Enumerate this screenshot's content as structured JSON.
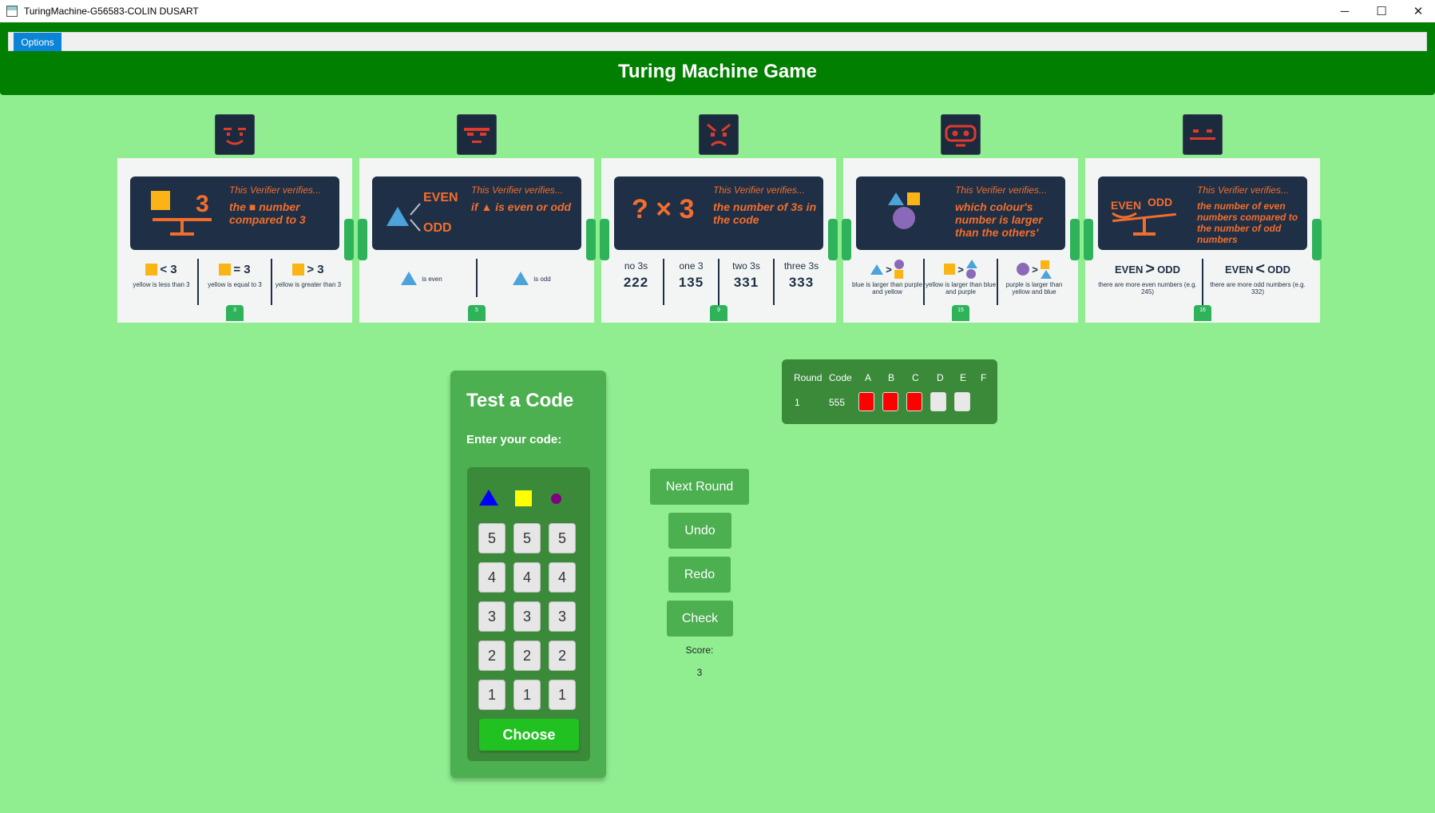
{
  "window": {
    "title": "TuringMachine-G56583-COLIN DUSART",
    "minimize": "─",
    "maximize": "☐",
    "close": "✕"
  },
  "menu": {
    "options_label": "Options"
  },
  "header": {
    "title": "Turing Machine Game"
  },
  "verifiers": [
    {
      "card_title": "This Verifier verifies...",
      "text": "the ■ number compared to 3",
      "number": "3",
      "options": [
        {
          "symbol": "< 3",
          "caption": "yellow is less than 3"
        },
        {
          "symbol": "= 3",
          "caption": "yellow is equal to 3"
        },
        {
          "symbol": "> 3",
          "caption": "yellow is greater than 3"
        }
      ]
    },
    {
      "card_title": "This Verifier verifies...",
      "text": "if ▲ is even or odd",
      "number": "5",
      "panel_even": "EVEN",
      "panel_odd": "ODD",
      "options": [
        {
          "caption": "is even"
        },
        {
          "caption": "is odd"
        }
      ]
    },
    {
      "card_title": "This Verifier verifies...",
      "text": "the number of 3s in the code",
      "number": "9",
      "panel_symbol": "? × 3",
      "options": [
        {
          "label": "no 3s",
          "digits": "222"
        },
        {
          "label": "one 3",
          "digits": "135"
        },
        {
          "label": "two 3s",
          "digits": "331"
        },
        {
          "label": "three 3s",
          "digits": "333"
        }
      ]
    },
    {
      "card_title": "This Verifier verifies...",
      "text": "which colour's number is larger than the others'",
      "number": "15",
      "options": [
        {
          "caption": "blue is larger than purple and yellow"
        },
        {
          "caption": "yellow is larger than blue and purple"
        },
        {
          "caption": "purple is larger than yellow and blue"
        }
      ]
    },
    {
      "card_title": "This Verifier verifies...",
      "text": "the number of even numbers compared to the number of odd numbers",
      "number": "16",
      "panel_even": "EVEN",
      "panel_odd": "ODD",
      "options": [
        {
          "symbol_left": "EVEN",
          "symbol_mid": ">",
          "symbol_right": "ODD",
          "caption": "there are more even numbers (e.g. 245)"
        },
        {
          "symbol_left": "EVEN",
          "symbol_mid": "<",
          "symbol_right": "ODD",
          "caption": "there are more odd numbers (e.g. 332)"
        }
      ]
    }
  ],
  "test_panel": {
    "title": "Test a Code",
    "subtitle": "Enter your code:",
    "keys": [
      "5",
      "4",
      "3",
      "2",
      "1"
    ],
    "choose_label": "Choose",
    "shape_colors": {
      "blue": "#0000ff",
      "yellow": "#ffff00",
      "purple": "#800080"
    }
  },
  "actions": {
    "next_round": "Next Round",
    "undo": "Undo",
    "redo": "Redo",
    "check": "Check",
    "score_label": "Score:",
    "score_value": "3"
  },
  "history": {
    "headers": [
      "Round",
      "Code",
      "A",
      "B",
      "C",
      "D",
      "E",
      "F"
    ],
    "rows": [
      {
        "round": "1",
        "code": "555",
        "results": [
          "red",
          "red",
          "red",
          "gray",
          "gray"
        ]
      }
    ]
  },
  "colors": {
    "background": "#90ee90",
    "header": "#007f00",
    "panel": "#4caf50",
    "result_fail": "#ff0000",
    "result_neutral": "#e8e8e8"
  }
}
